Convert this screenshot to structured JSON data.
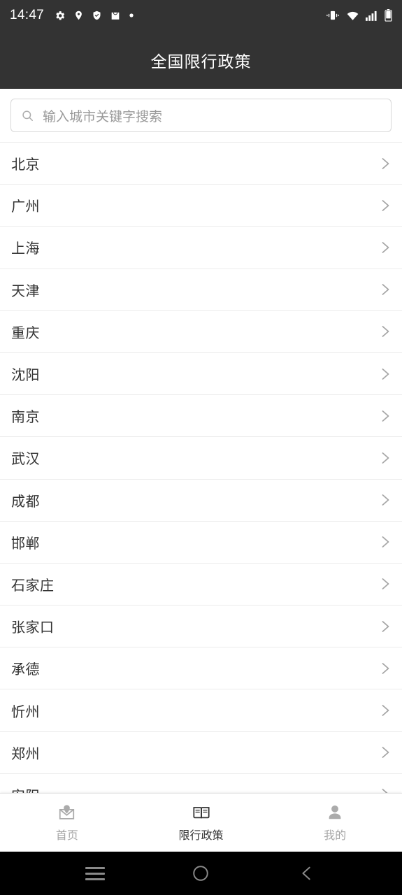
{
  "status_bar": {
    "time": "14:47",
    "left_icons": [
      "gear-icon",
      "location-pin-icon",
      "shield-check-icon",
      "shopping-bag-icon",
      "dot-icon"
    ],
    "right_icons": [
      "vibrate-icon",
      "wifi-icon",
      "signal-icon",
      "battery-icon"
    ]
  },
  "header": {
    "title": "全国限行政策",
    "background": "#333333",
    "text_color": "#ffffff"
  },
  "search": {
    "placeholder": "输入城市关键字搜索",
    "value": "",
    "icon": "search-icon"
  },
  "city_list": {
    "chevron_icon": "chevron-right-icon",
    "items": [
      {
        "name": "北京"
      },
      {
        "name": "广州"
      },
      {
        "name": "上海"
      },
      {
        "name": "天津"
      },
      {
        "name": "重庆"
      },
      {
        "name": "沈阳"
      },
      {
        "name": "南京"
      },
      {
        "name": "武汉"
      },
      {
        "name": "成都"
      },
      {
        "name": "邯郸"
      },
      {
        "name": "石家庄"
      },
      {
        "name": "张家口"
      },
      {
        "name": "承德"
      },
      {
        "name": "忻州"
      },
      {
        "name": "郑州"
      },
      {
        "name": "安阳"
      }
    ]
  },
  "tab_bar": {
    "active_color": "#333333",
    "inactive_color": "#a6a6a6",
    "tabs": [
      {
        "label": "首页",
        "icon": "home-location-icon",
        "active": false
      },
      {
        "label": "限行政策",
        "icon": "book-icon",
        "active": true
      },
      {
        "label": "我的",
        "icon": "person-icon",
        "active": false
      }
    ]
  },
  "android_nav": {
    "buttons": [
      {
        "icon": "recents-menu-icon"
      },
      {
        "icon": "home-circle-icon"
      },
      {
        "icon": "back-chevron-icon"
      }
    ]
  }
}
